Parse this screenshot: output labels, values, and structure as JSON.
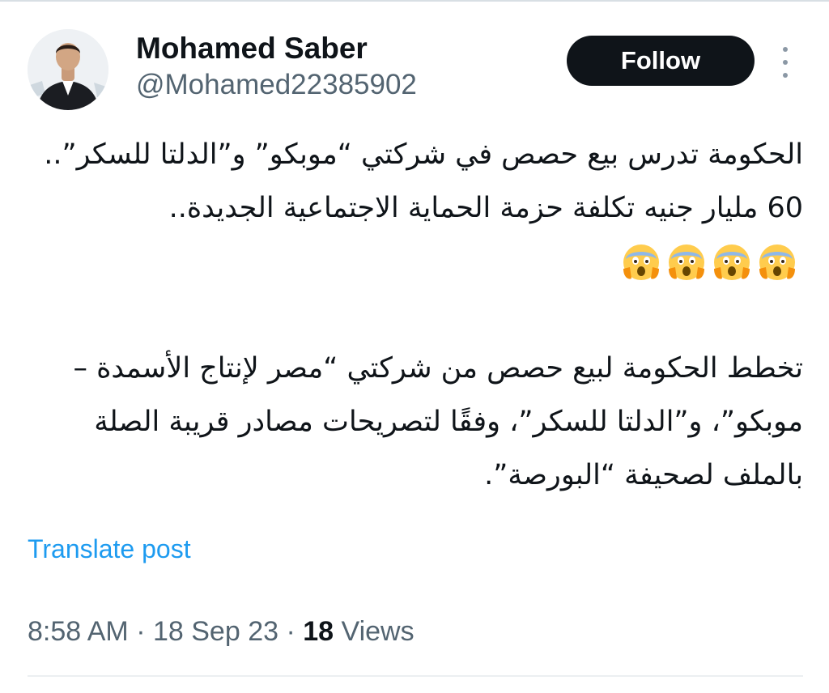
{
  "author": {
    "display_name": "Mohamed Saber",
    "handle": "@Mohamed22385902",
    "avatar": "profile-photo"
  },
  "actions": {
    "follow_label": "Follow",
    "more_icon": "more-vertical-icon"
  },
  "post": {
    "paragraph_1": "الحكومة تدرس بيع حصص في شركتي “موبكو” و”الدلتا للسكر”.. 60 مليار جنيه تكلفة حزمة الحماية الاجتماعية الجديدة..",
    "emojis": [
      "😱",
      "😱",
      "😱",
      "😱"
    ],
    "emoji_name": "face-screaming-in-fear-icon",
    "paragraph_2": "تخطط الحكومة لبيع حصص من شركتي “مصر لإنتاج الأسمدة – موبكو”، و”الدلتا للسكر”، وفقًا لتصريحات مصادر قريبة الصلة بالملف لصحيفة “البورصة”."
  },
  "translate_label": "Translate post",
  "meta": {
    "time": "8:58 AM",
    "separator": "·",
    "date": "18 Sep 23",
    "views_count": "18",
    "views_label": "Views"
  },
  "colors": {
    "text": "#0f1419",
    "secondary": "#536471",
    "link": "#1d9bf0",
    "button_bg": "#0f1419",
    "emoji_face": "#ffcc4d"
  }
}
